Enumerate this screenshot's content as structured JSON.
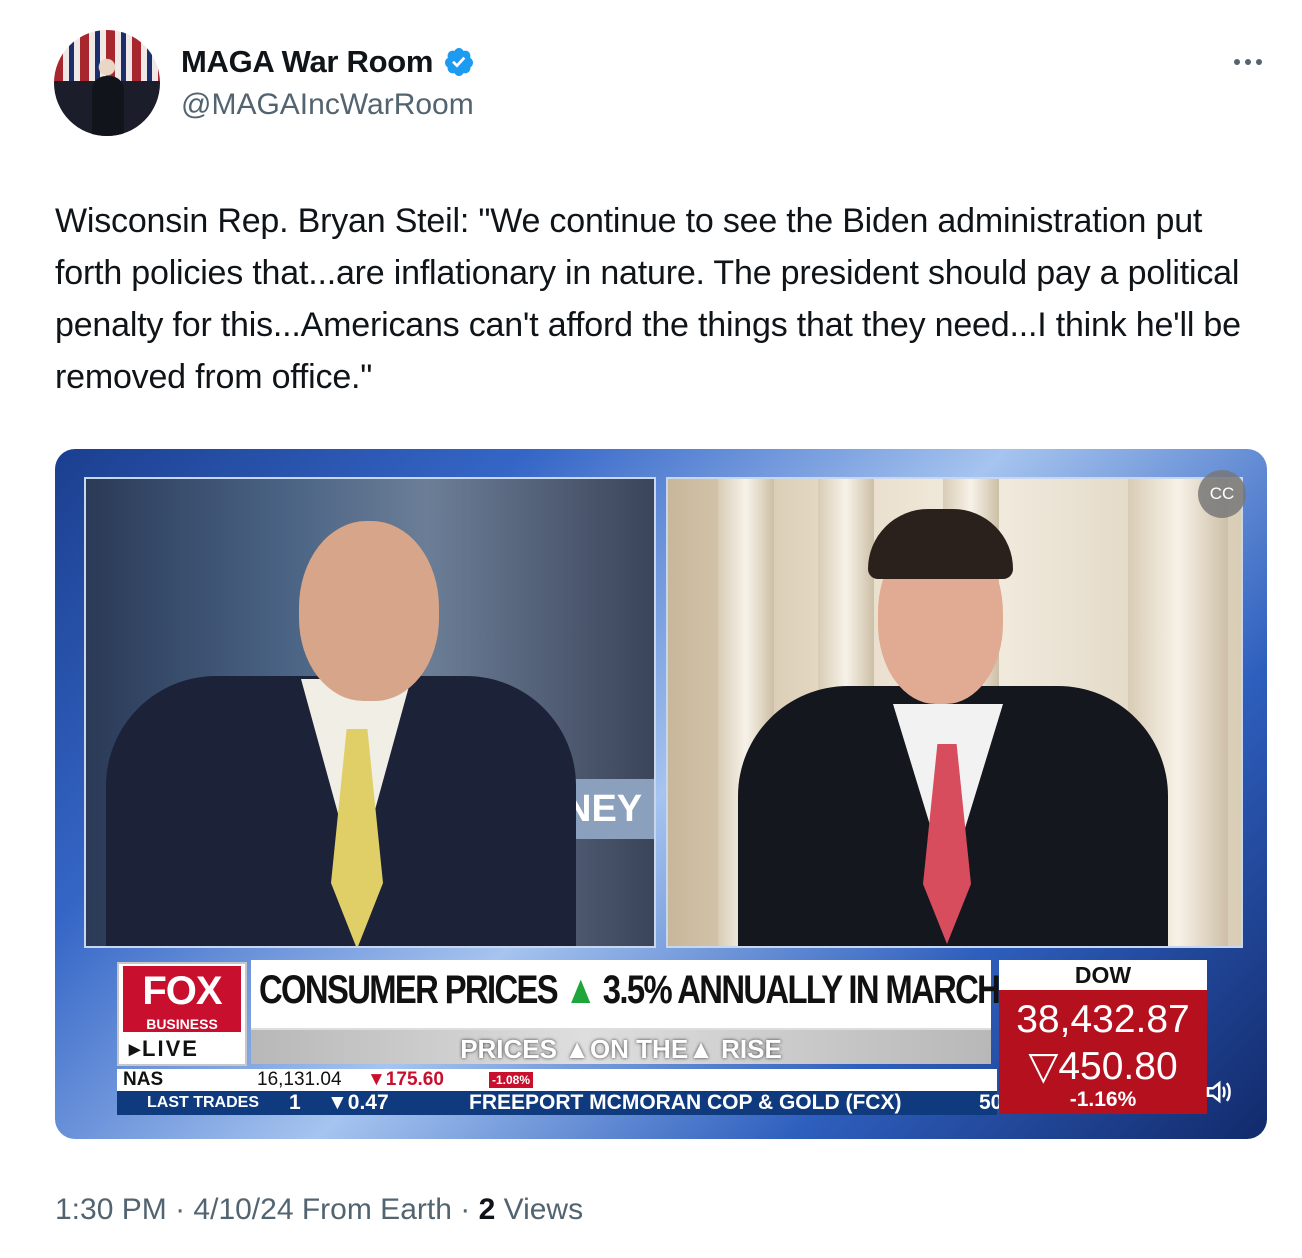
{
  "author": {
    "name": "MAGA War Room",
    "handle": "@MAGAIncWarRoom",
    "verified": true,
    "badge_color": "#1d9bf0"
  },
  "tweet": {
    "text": "Wisconsin Rep. Bryan Steil: \"We continue to see the Biden administration put forth policies that...are inflationary in nature. The president should pay a political penalty for this...Americans can't afford the things that they need...I think he'll be removed from office.\""
  },
  "video": {
    "network": {
      "logo": "FOX",
      "sub": "BUSINESS",
      "live": "LIVE"
    },
    "headline_pre": "CONSUMER PRICES",
    "headline_arrow": "▲",
    "headline_post": "3.5% ANNUALLY IN MARCH",
    "subhead": "PRICES ▲ON THE▲ RISE",
    "ticker_top": {
      "index": "NAS",
      "value": "16,131.04",
      "change": "▼175.60",
      "pct": "-1.08%"
    },
    "ticker_bottom": {
      "label": "LAST TRADES",
      "item1": "1",
      "change": "▼0.47",
      "company": "FREEPORT MCMORAN COP & GOLD (FCX)",
      "trail": "50"
    },
    "dow": {
      "label": "DOW",
      "value": "38,432.87",
      "change": "▽450.80",
      "pct": "-1.16%"
    },
    "captions_icon": "closed-captions-icon",
    "volume_icon": "speaker-icon",
    "set_text": "NEY"
  },
  "meta": {
    "time": "1:30 PM",
    "sep1": "·",
    "date": "4/10/24",
    "source": "From Earth",
    "sep2": "·",
    "views_count": "2",
    "views_label": "Views"
  }
}
